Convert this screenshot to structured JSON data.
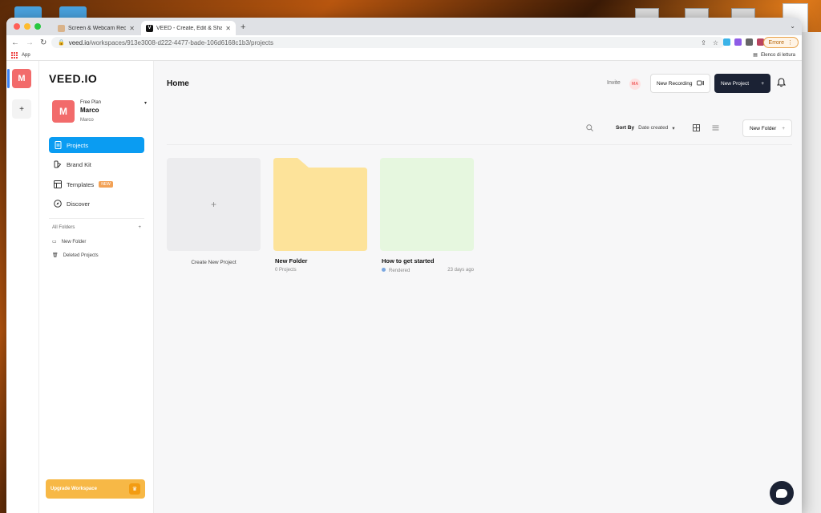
{
  "browser": {
    "tabs": [
      {
        "title": "Screen & Webcam Recorder -",
        "active": false
      },
      {
        "title": "VEED - Create, Edit & Share V",
        "active": true
      }
    ],
    "url_domain": "veed.io",
    "url_path": "/workspaces/913e3008-d222-4477-bade-106d6168c1b3/projects",
    "error_label": "Errore",
    "bookmarks_app": "App",
    "reading_list": "Elenco di lettura"
  },
  "rail": {
    "workspace_initial": "M",
    "add_symbol": "+"
  },
  "sidebar": {
    "logo": "VEED.IO",
    "account": {
      "initial": "M",
      "plan": "Free Plan",
      "name": "Marco",
      "subtitle": "Marco"
    },
    "nav": [
      {
        "label": "Projects",
        "icon": "document-icon",
        "active": true
      },
      {
        "label": "Brand Kit",
        "icon": "brand-kit-icon",
        "active": false
      },
      {
        "label": "Templates",
        "icon": "templates-icon",
        "active": false,
        "badge": "NEW"
      },
      {
        "label": "Discover",
        "icon": "compass-icon",
        "active": false
      }
    ],
    "folders_header": "All Folders",
    "folders": [
      {
        "label": "New Folder",
        "icon": "folder-icon"
      },
      {
        "label": "Deleted Projects",
        "icon": "trash-icon"
      }
    ],
    "upgrade_label": "Upgrade Workspace"
  },
  "header": {
    "title": "Home",
    "invite": "Invite",
    "avatar_initials": "MA",
    "new_recording": "New Recording",
    "new_project": "New Project",
    "new_project_icon": "+"
  },
  "toolbar": {
    "sort_label": "Sort By",
    "sort_value": "Date created",
    "new_folder": "New Folder",
    "new_folder_icon": "+"
  },
  "cards": [
    {
      "kind": "create",
      "label": "Create New Project",
      "plus": "+"
    },
    {
      "kind": "folder",
      "title": "New Folder",
      "meta": "0 Projects"
    },
    {
      "kind": "video",
      "title": "How to get started",
      "status": "Rendered",
      "age": "23 days ago"
    }
  ],
  "colors": {
    "accent": "#0a9cf2",
    "brand": "#f26b6b",
    "dark_button": "#1b2234",
    "folder": "#fde39a",
    "upgrade": "#f7b846"
  }
}
